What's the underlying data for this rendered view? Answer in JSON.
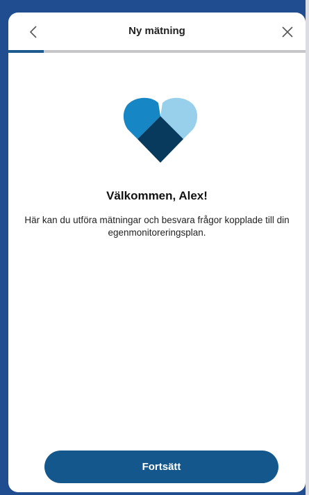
{
  "header": {
    "title": "Ny mätning",
    "back_icon": "chevron-left-icon",
    "close_icon": "close-icon"
  },
  "progress": {
    "fraction": 0.12,
    "fill_color": "#1d5a8e",
    "track_color": "#c6c6c9"
  },
  "hero": {
    "icon": "heart-logo-icon",
    "colors": [
      "#1686c4",
      "#98d0ec",
      "#073a5c"
    ]
  },
  "content": {
    "welcome": "Välkommen, Alex!",
    "description": "Här kan du utföra mätningar och besvara frågor kopplade till din egenmonitoreringsplan."
  },
  "footer": {
    "continue_label": "Fortsätt",
    "button_color": "#14578d"
  }
}
